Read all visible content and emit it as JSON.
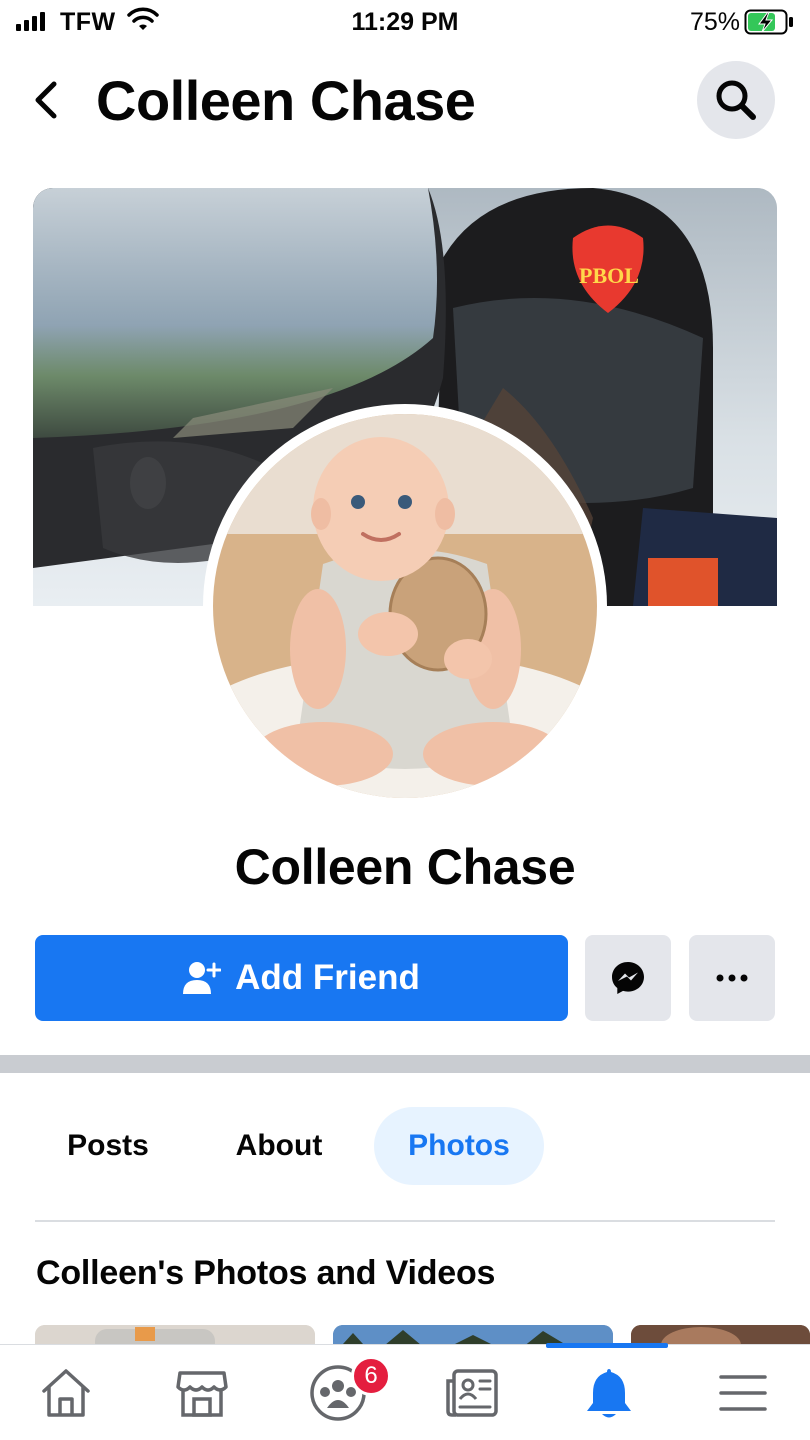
{
  "status_bar": {
    "carrier": "TFW",
    "time": "11:29 PM",
    "battery_percent": "75%",
    "battery_level": 0.75,
    "signal_bars": 4,
    "icons": [
      "signal-icon",
      "wifi-icon",
      "battery-charging-icon"
    ]
  },
  "header": {
    "title": "Colleen Chase",
    "back_icon": "chevron-left-icon",
    "search_icon": "search-icon"
  },
  "profile": {
    "name": "Colleen Chase",
    "cover_photo": "cover-photo",
    "profile_photo": "profile-photo",
    "cover_badge_text": "PBOL"
  },
  "actions": {
    "add_friend_label": "Add Friend",
    "add_friend_icon": "add-user-icon",
    "messenger_icon": "messenger-icon",
    "more_icon": "ellipsis-icon"
  },
  "tabs": [
    {
      "label": "Posts",
      "active": false
    },
    {
      "label": "About",
      "active": false
    },
    {
      "label": "Photos",
      "active": true
    }
  ],
  "photos_section": {
    "heading": "Colleen's Photos and Videos"
  },
  "bottom_nav": {
    "items": [
      {
        "icon": "home-icon",
        "active": false
      },
      {
        "icon": "marketplace-icon",
        "active": false
      },
      {
        "icon": "groups-icon",
        "active": false,
        "badge": "6"
      },
      {
        "icon": "news-icon",
        "active": false
      },
      {
        "icon": "bell-icon",
        "active": true
      },
      {
        "icon": "menu-icon",
        "active": false
      }
    ]
  },
  "colors": {
    "accent": "#1877f2",
    "accent_light": "#e7f3ff",
    "button_gray": "#e4e6eb",
    "badge_red": "#e41e3f",
    "text": "#050505"
  }
}
